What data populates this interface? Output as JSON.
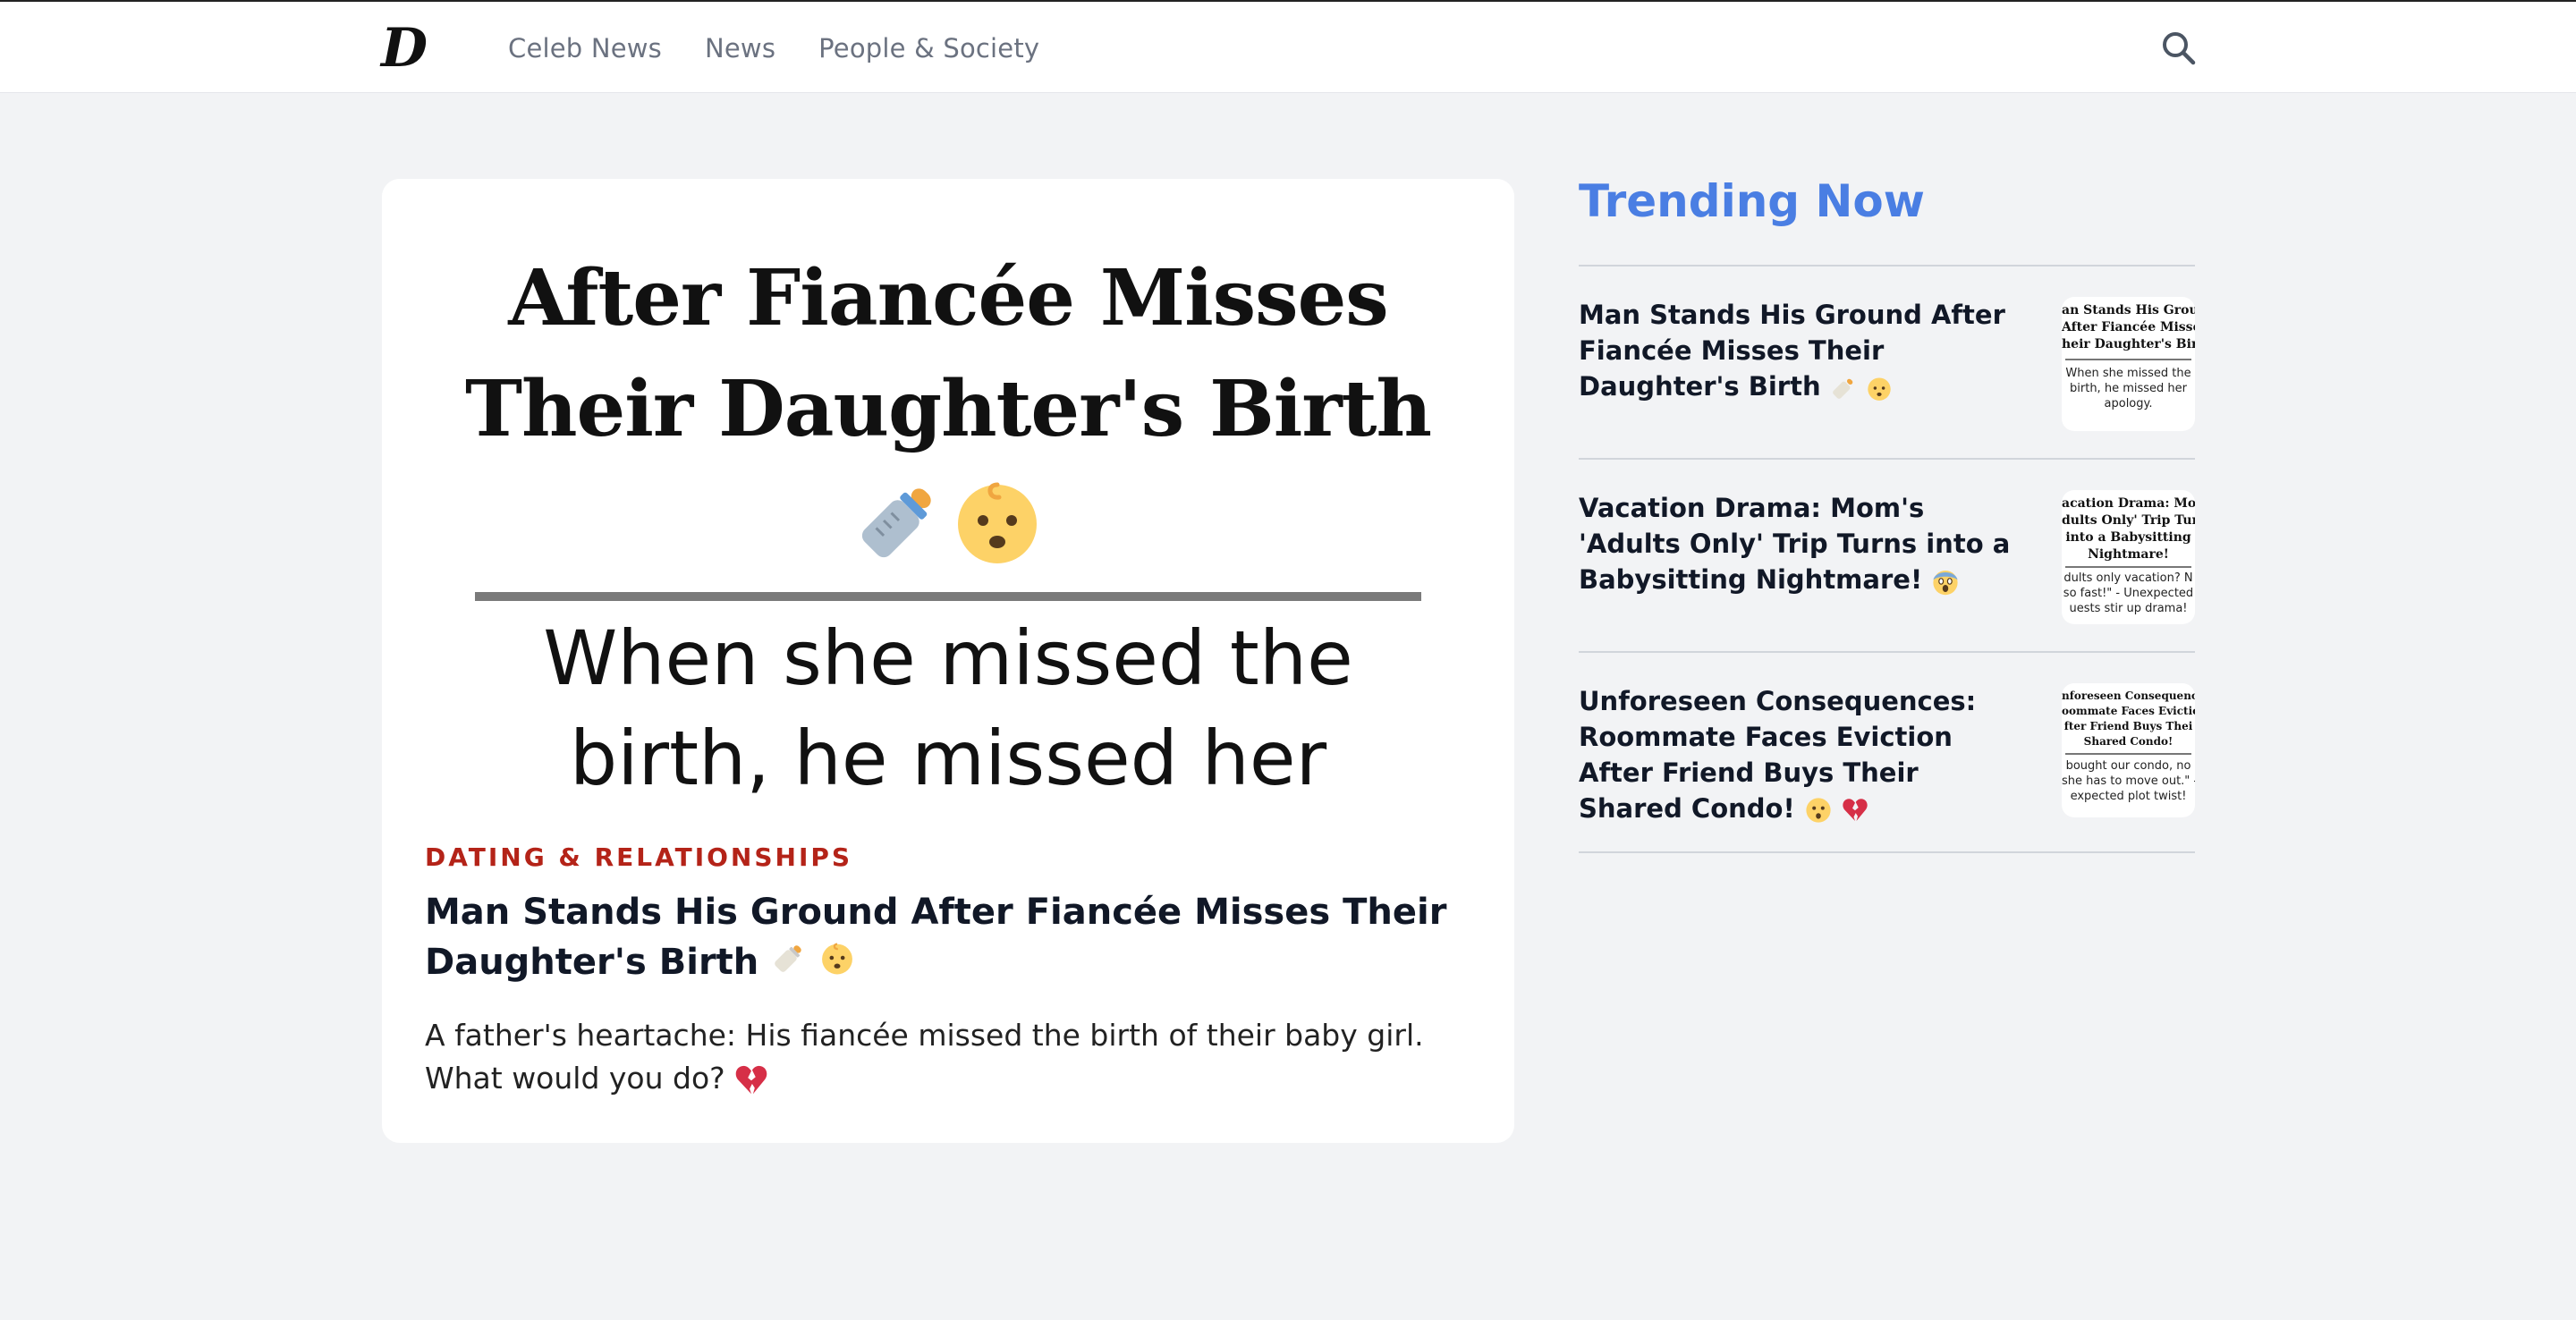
{
  "header": {
    "logo": "D",
    "nav": [
      "Celeb News",
      "News",
      "People & Society"
    ],
    "search_icon": "search-icon"
  },
  "featured": {
    "image": {
      "title": "After Fiancée Misses Their Daughter's Birth",
      "emoji": [
        "baby-bottle-icon",
        "baby-face-icon"
      ],
      "subtitle": "When she missed the birth, he missed her"
    },
    "category": "DATING & RELATIONSHIPS",
    "headline": "Man Stands His Ground After Fiancée Misses Their Daughter's Birth",
    "headline_emoji": [
      "baby-bottle-icon",
      "baby-face-icon"
    ],
    "excerpt": "A father's heartache: His fiancée missed the birth of their baby girl. What would you do?",
    "excerpt_emoji": [
      "broken-heart-icon"
    ]
  },
  "trending": {
    "title": "Trending Now",
    "items": [
      {
        "text": "Man Stands His Ground After Fiancée Misses Their Daughter's Birth",
        "emoji": [
          "baby-bottle-icon",
          "baby-face-icon"
        ],
        "thumb_title": [
          "an Stands His Groun",
          "After Fiancée Misses",
          "heir Daughter's Birt"
        ],
        "thumb_sub": [
          "When she missed the",
          "birth, he missed her",
          "apology."
        ]
      },
      {
        "text": "Vacation Drama: Mom's 'Adults Only' Trip Turns into a Babysitting Nightmare!",
        "emoji": [
          "scream-face-icon"
        ],
        "thumb_title": [
          "acation Drama: Mon",
          "dults Only' Trip Turi",
          "into a Babysitting",
          "Nightmare!"
        ],
        "thumb_sub": [
          "dults only vacation? N",
          "so fast!\" - Unexpected",
          "uests stir up drama!"
        ]
      },
      {
        "text": "Unforeseen Consequences: Roommate Faces Eviction After Friend Buys Their Shared Condo!",
        "emoji": [
          "shocked-face-icon",
          "broken-heart-icon"
        ],
        "thumb_title": [
          "nforeseen Consequenc",
          "oommate Faces Evictio",
          "fter Friend Buys Thei",
          "Shared Condo!"
        ],
        "thumb_sub": [
          "bought our condo, no",
          "she has to move out.\" -",
          "expected plot twist!"
        ]
      }
    ]
  },
  "colors": {
    "accent": "#4a7ee3",
    "category": "#b42318",
    "background": "#f2f3f5"
  }
}
